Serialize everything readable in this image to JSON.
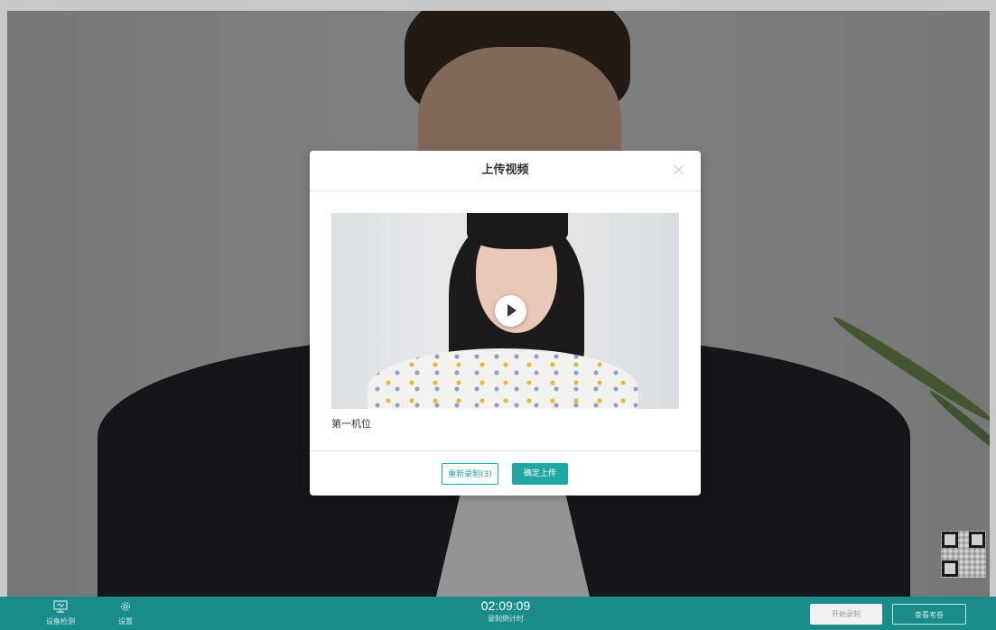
{
  "dialog": {
    "title": "上传视频",
    "camera_label": "第一机位",
    "rerecord_label": "重新录制(3)",
    "confirm_label": "确定上传"
  },
  "bottom_bar": {
    "device_check_label": "设备检测",
    "settings_label": "设置",
    "timer_value": "02:09:09",
    "timer_label": "录制倒计时",
    "start_record_label": "开始录制",
    "view_exam_label": "查看考卷"
  },
  "icons": {
    "monitor": "monitor-icon",
    "gear": "gear-icon",
    "play": "play-icon",
    "close": "close-icon",
    "qr": "qr-code"
  },
  "colors": {
    "accent": "#20a7a5",
    "bottom_bar": "#1a8d8b"
  }
}
